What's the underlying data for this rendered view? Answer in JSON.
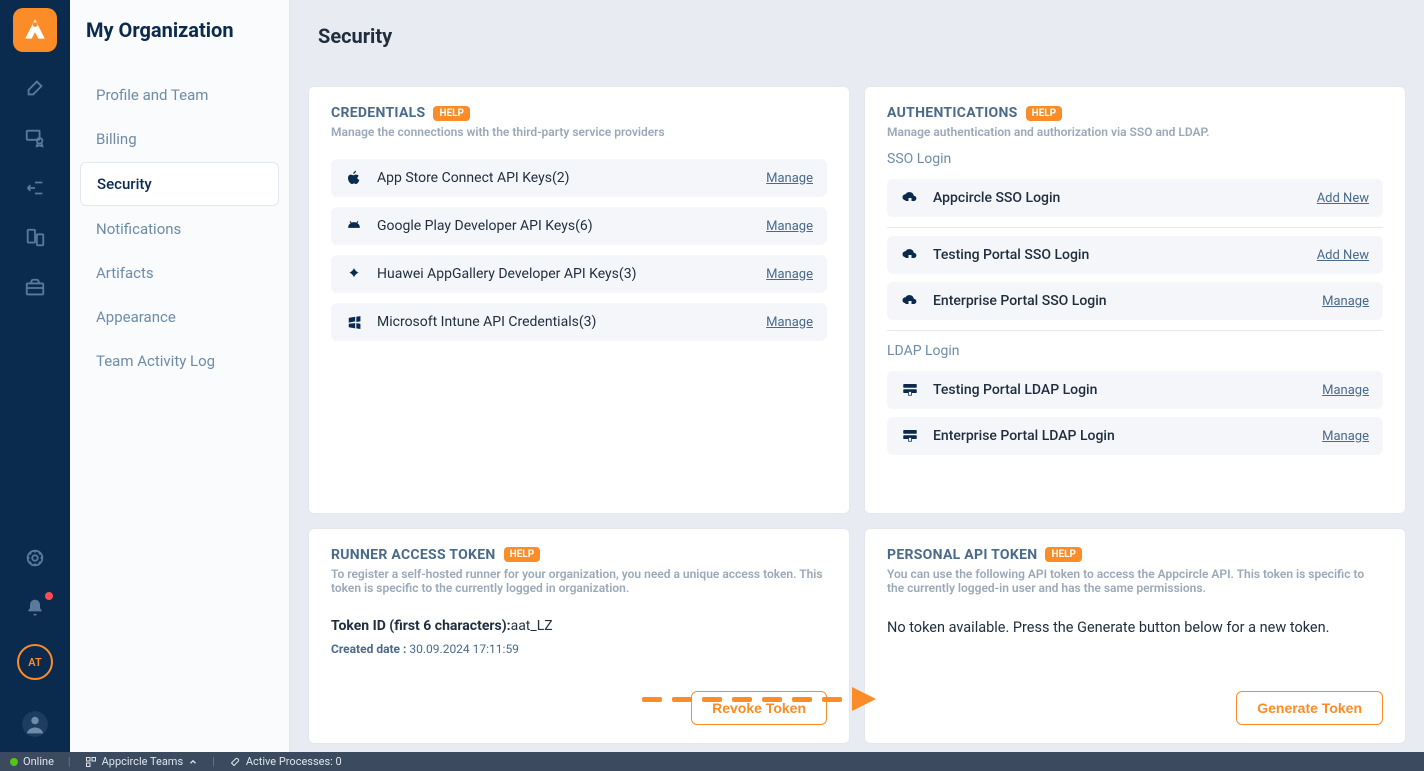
{
  "sidebar": {
    "title": "My Organization",
    "items": [
      {
        "label": "Profile and Team"
      },
      {
        "label": "Billing"
      },
      {
        "label": "Security"
      },
      {
        "label": "Notifications"
      },
      {
        "label": "Artifacts"
      },
      {
        "label": "Appearance"
      },
      {
        "label": "Team Activity Log"
      }
    ]
  },
  "header": {
    "title": "Security"
  },
  "credentials": {
    "title": "CREDENTIALS",
    "help": "HELP",
    "sub": "Manage the connections with the third-party service providers",
    "rows": [
      {
        "name": "App Store Connect API Keys",
        "count": "(2)",
        "action": "Manage",
        "icon": "apple"
      },
      {
        "name": "Google Play Developer API Keys",
        "count": "(6)",
        "action": "Manage",
        "icon": "android"
      },
      {
        "name": "Huawei AppGallery Developer API Keys",
        "count": "(3)",
        "action": "Manage",
        "icon": "huawei"
      },
      {
        "name": "Microsoft Intune API Credentials",
        "count": "(3)",
        "action": "Manage",
        "icon": "microsoft"
      }
    ]
  },
  "authentications": {
    "title": "AUTHENTICATIONS",
    "help": "HELP",
    "sub": "Manage authentication and authorization via SSO and LDAP.",
    "sso_label": "SSO Login",
    "ldap_label": "LDAP Login",
    "sso_rows": [
      {
        "name": "Appcircle SSO Login",
        "action": "Add New"
      },
      {
        "name": "Testing Portal SSO Login",
        "action": "Add New"
      },
      {
        "name": "Enterprise Portal SSO Login",
        "action": "Manage"
      }
    ],
    "ldap_rows": [
      {
        "name": "Testing Portal LDAP Login",
        "action": "Manage"
      },
      {
        "name": "Enterprise Portal LDAP Login",
        "action": "Manage"
      }
    ]
  },
  "runner_token": {
    "title": "RUNNER ACCESS TOKEN",
    "help": "HELP",
    "sub": "To register a self-hosted runner for your organization, you need a unique access token. This token is specific to the currently logged in organization.",
    "id_label": "Token ID (first 6 characters):",
    "id_value": "aat_LZ",
    "created_label": "Created date : ",
    "created_value": "30.09.2024 17:11:59",
    "button": "Revoke Token"
  },
  "personal_token": {
    "title": "PERSONAL API TOKEN",
    "help": "HELP",
    "sub": "You can use the following API token to access the Appcircle API. This token is specific to the currently logged-in user and has the same permissions.",
    "none_msg": "No token available. Press the Generate button below for a new token.",
    "button": "Generate Token"
  },
  "status": {
    "online": "Online",
    "teams": "Appcircle Teams",
    "processes": "Active Processes: 0"
  },
  "avatar": "AT"
}
